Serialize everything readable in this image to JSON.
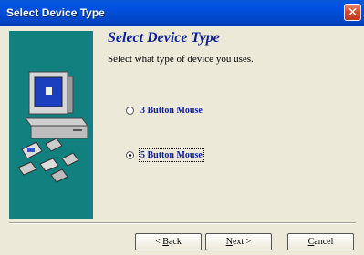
{
  "window": {
    "title": "Select Device Type",
    "close_symbol": "✕"
  },
  "page": {
    "heading": "Select Device Type",
    "subtitle": "Select what type of device you uses."
  },
  "options": [
    {
      "label": "3 Button Mouse",
      "checked": false
    },
    {
      "label": "5 Button Mouse",
      "checked": true
    }
  ],
  "buttons": {
    "back": {
      "prefix": "< ",
      "mnemonic": "B",
      "rest": "ack"
    },
    "next": {
      "mnemonic": "N",
      "rest": "ext >"
    },
    "cancel": {
      "mnemonic": "C",
      "rest": "ancel"
    }
  },
  "colors": {
    "side_panel": "#138080",
    "heading": "#0b1f9c"
  }
}
